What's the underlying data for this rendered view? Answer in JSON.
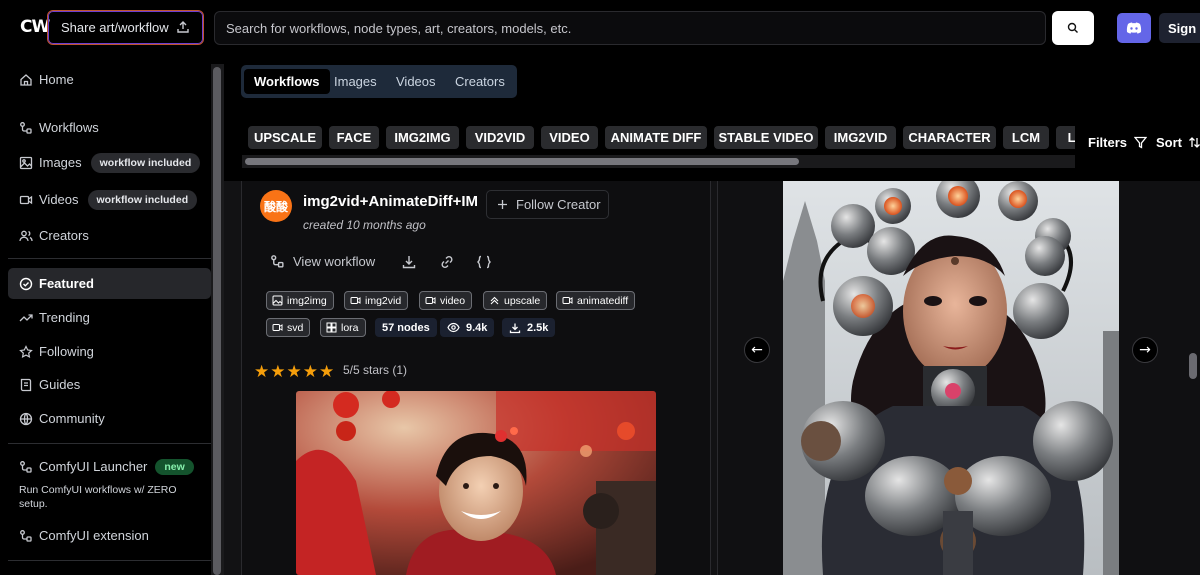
{
  "header": {
    "logo": "CW",
    "share_label": "Share art/workflow",
    "search_placeholder": "Search for workflows, node types, art, creators, models, etc.",
    "signin_label": "Sign In"
  },
  "sidebar": {
    "items": [
      {
        "label": "Home",
        "icon": "home-icon"
      },
      {
        "label": "Workflows",
        "icon": "workflow-icon"
      },
      {
        "label": "Images",
        "icon": "image-icon",
        "badge": "workflow included"
      },
      {
        "label": "Videos",
        "icon": "video-icon",
        "badge": "workflow included"
      },
      {
        "label": "Creators",
        "icon": "users-icon"
      },
      {
        "label": "Featured",
        "icon": "check-circle-icon",
        "active": true
      },
      {
        "label": "Trending",
        "icon": "trending-icon"
      },
      {
        "label": "Following",
        "icon": "star-icon"
      },
      {
        "label": "Guides",
        "icon": "book-icon"
      },
      {
        "label": "Community",
        "icon": "globe-icon"
      }
    ],
    "launcher": {
      "label": "ComfyUI Launcher",
      "badge": "new",
      "description": "Run ComfyUI workflows w/ ZERO setup."
    },
    "extension": {
      "label": "ComfyUI extension"
    }
  },
  "tabs": [
    "Workflows",
    "Images",
    "Videos",
    "Creators"
  ],
  "active_tab": "Workflows",
  "chips": [
    "UPSCALE",
    "FACE",
    "IMG2IMG",
    "VID2VID",
    "VIDEO",
    "ANIMATE DIFF",
    "STABLE VIDEO",
    "IMG2VID",
    "CHARACTER",
    "LCM",
    "LORA"
  ],
  "toolbar": {
    "filters_label": "Filters",
    "sort_label": "Sort"
  },
  "card": {
    "avatar_text": "酸酸",
    "title": "img2vid+AnimateDiff+IM",
    "date": "created 10 months ago",
    "follow_label": "Follow Creator",
    "view_label": "View workflow",
    "tags": [
      "img2img",
      "img2vid",
      "video",
      "upscale",
      "animatediff",
      "svd",
      "lora"
    ],
    "nodes": "57 nodes",
    "views": "9.4k",
    "downloads": "2.5k",
    "rating": "5/5 stars (1)",
    "stars": 5
  },
  "colors": {
    "accent": "#6466e8",
    "star": "#f59e0b",
    "avatar": "#f97316",
    "new_badge": "#14532d"
  }
}
